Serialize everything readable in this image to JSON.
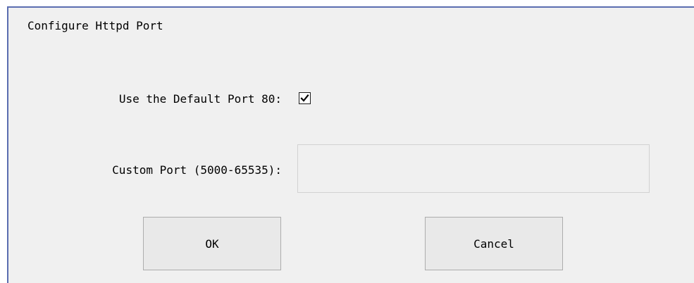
{
  "dialog": {
    "title": "Configure Httpd Port",
    "default_port_label": "Use the Default Port 80:",
    "default_port_checked": true,
    "custom_port_label": "Custom Port (5000-65535):",
    "custom_port_value": "",
    "ok_label": "OK",
    "cancel_label": "Cancel"
  },
  "colors": {
    "dialog_background": "#f0f0f0",
    "dialog_border": "#5a6db0",
    "button_background": "#e9e9e9",
    "button_border": "#adadad"
  },
  "icons": {
    "checkbox_mark": "check-icon"
  }
}
